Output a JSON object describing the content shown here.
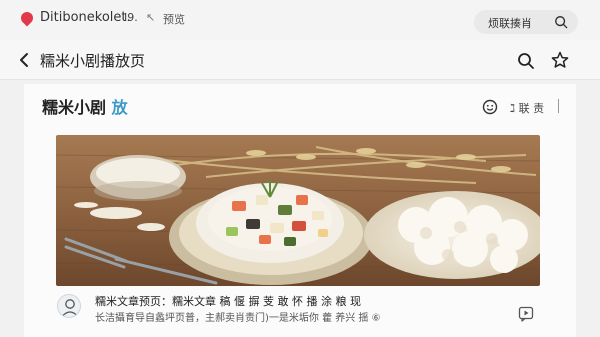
{
  "topbar": {
    "site_name": "Ditibonekolet.",
    "site_num": "I9.",
    "mini_icon": "↖",
    "preview": "预览",
    "search_text": "烦联揍肖",
    "icons": {
      "logo": "brand-logo-icon",
      "search": "search-icon"
    },
    "brand_color": "#e0394a"
  },
  "navbar": {
    "title": "糯米小剧播放页",
    "icons": {
      "back": "chevron-left-icon",
      "search": "search-icon",
      "star": "star-icon"
    }
  },
  "header": {
    "title": "糯米小剧",
    "title_accent": "放",
    "accent_color": "#3b9ac6",
    "action_label": "ℷ 联 责",
    "icons": {
      "face": "smiley-icon"
    }
  },
  "hero": {
    "image_name": "rice-dish-photo"
  },
  "footer": {
    "line1": "糯米文章预页：糯米文章 稿 偃 摒 芰 敢 怀 播 涂 粮 现",
    "line2": "长洁攝育导自蠡坪页普，主郝卖肖责门)一是米垢你 藿 养兴 揺 ⑥",
    "icons": {
      "avatar": "user-avatar-icon",
      "play": "play-comment-icon"
    }
  }
}
